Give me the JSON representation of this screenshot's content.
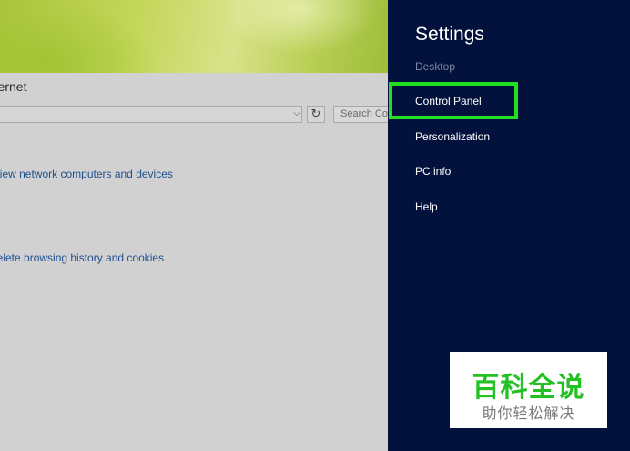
{
  "window": {
    "title": "Internet",
    "search_placeholder": "Search Control Panel",
    "links": [
      "View network computers and devices",
      "Delete browsing history and cookies"
    ]
  },
  "charm": {
    "title": "Settings",
    "subtitle": "Desktop",
    "items": [
      "Control Panel",
      "Personalization",
      "PC info",
      "Help"
    ],
    "highlight_color": "#22e021",
    "background_color": "#02123c"
  },
  "watermark": {
    "main": "百科全说",
    "sub": "助你轻松解决"
  }
}
